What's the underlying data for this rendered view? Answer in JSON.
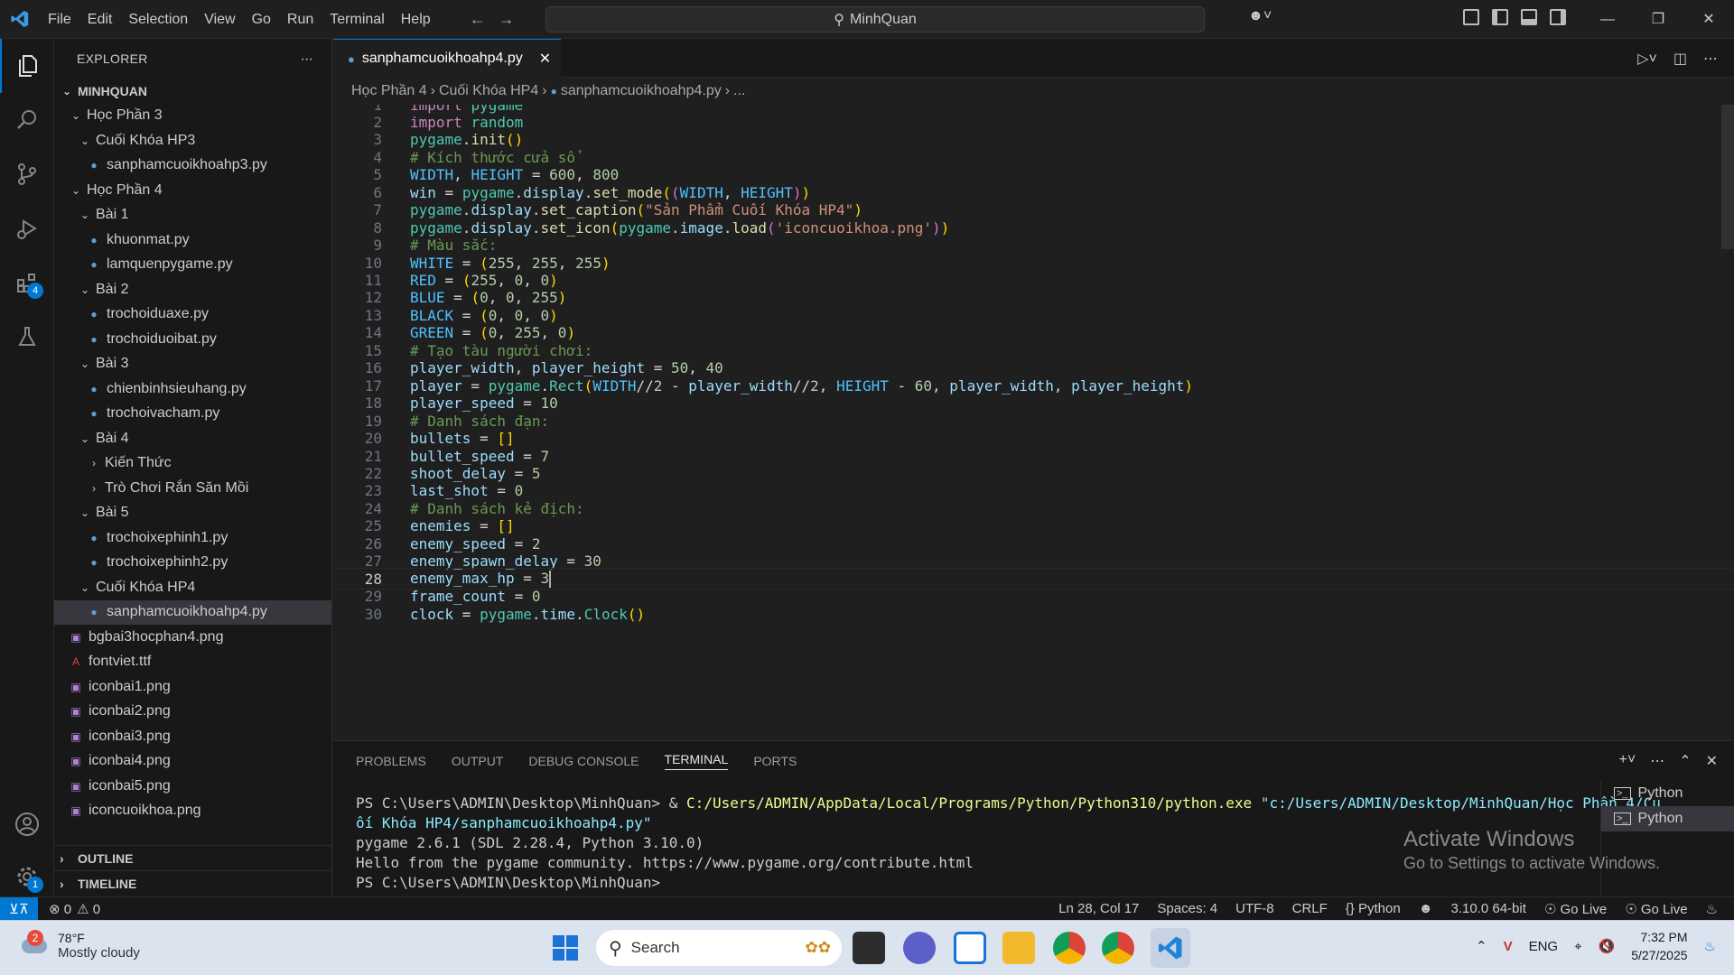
{
  "titlebar": {
    "menu": [
      "File",
      "Edit",
      "Selection",
      "View",
      "Go",
      "Run",
      "Terminal",
      "Help"
    ],
    "search": "MinhQuan"
  },
  "activitybar": {
    "extensions_badge": "4",
    "settings_badge": "1"
  },
  "explorer": {
    "title": "EXPLORER",
    "root": "MINHQUAN",
    "tree": [
      {
        "label": "Học Phần 3",
        "depth": 1,
        "kind": "folder-open"
      },
      {
        "label": "Cuối Khóa HP3",
        "depth": 2,
        "kind": "folder-open"
      },
      {
        "label": "sanphamcuoikhoahp3.py",
        "depth": 3,
        "kind": "py"
      },
      {
        "label": "Học Phần 4",
        "depth": 1,
        "kind": "folder-open"
      },
      {
        "label": "Bài 1",
        "depth": 2,
        "kind": "folder-open"
      },
      {
        "label": "khuonmat.py",
        "depth": 3,
        "kind": "py"
      },
      {
        "label": "lamquenpygame.py",
        "depth": 3,
        "kind": "py"
      },
      {
        "label": "Bài 2",
        "depth": 2,
        "kind": "folder-open"
      },
      {
        "label": "trochoiduaxe.py",
        "depth": 3,
        "kind": "py"
      },
      {
        "label": "trochoiduoibat.py",
        "depth": 3,
        "kind": "py"
      },
      {
        "label": "Bài 3",
        "depth": 2,
        "kind": "folder-open"
      },
      {
        "label": "chienbinhsieuhang.py",
        "depth": 3,
        "kind": "py"
      },
      {
        "label": "trochoivacham.py",
        "depth": 3,
        "kind": "py"
      },
      {
        "label": "Bài 4",
        "depth": 2,
        "kind": "folder-open"
      },
      {
        "label": "Kiến Thức",
        "depth": 3,
        "kind": "folder-closed"
      },
      {
        "label": "Trò Chơi Rắn Săn Mồi",
        "depth": 3,
        "kind": "folder-closed"
      },
      {
        "label": "Bài 5",
        "depth": 2,
        "kind": "folder-open"
      },
      {
        "label": "trochoixephinh1.py",
        "depth": 3,
        "kind": "py"
      },
      {
        "label": "trochoixephinh2.py",
        "depth": 3,
        "kind": "py"
      },
      {
        "label": "Cuối Khóa HP4",
        "depth": 2,
        "kind": "folder-open"
      },
      {
        "label": "sanphamcuoikhoahp4.py",
        "depth": 3,
        "kind": "py",
        "selected": true
      },
      {
        "label": "bgbai3hocphan4.png",
        "depth": 1,
        "kind": "img"
      },
      {
        "label": "fontviet.ttf",
        "depth": 1,
        "kind": "font"
      },
      {
        "label": "iconbai1.png",
        "depth": 1,
        "kind": "img"
      },
      {
        "label": "iconbai2.png",
        "depth": 1,
        "kind": "img"
      },
      {
        "label": "iconbai3.png",
        "depth": 1,
        "kind": "img"
      },
      {
        "label": "iconbai4.png",
        "depth": 1,
        "kind": "img"
      },
      {
        "label": "iconbai5.png",
        "depth": 1,
        "kind": "img"
      },
      {
        "label": "iconcuoikhoa.png",
        "depth": 1,
        "kind": "img"
      }
    ],
    "outline": "OUTLINE",
    "timeline": "TIMELINE"
  },
  "editor": {
    "tab": "sanphamcuoikhoahp4.py",
    "breadcrumb": [
      "Học Phần 4",
      "Cuối Khóa HP4",
      "sanphamcuoikhoahp4.py",
      "..."
    ],
    "current_line": 28
  },
  "code_lines": [
    [
      [
        "kw",
        "import"
      ],
      [
        "op",
        " "
      ],
      [
        "cls",
        "pygame"
      ]
    ],
    [
      [
        "kw",
        "import"
      ],
      [
        "op",
        " "
      ],
      [
        "cls",
        "random"
      ]
    ],
    [
      [
        "cls",
        "pygame"
      ],
      [
        "op",
        "."
      ],
      [
        "fn",
        "init"
      ],
      [
        "br1",
        "()"
      ]
    ],
    [
      [
        "cm",
        "# Kích thước cửa sổ"
      ]
    ],
    [
      [
        "con",
        "WIDTH"
      ],
      [
        "op",
        ", "
      ],
      [
        "con",
        "HEIGHT"
      ],
      [
        "op",
        " = "
      ],
      [
        "num",
        "600"
      ],
      [
        "op",
        ", "
      ],
      [
        "num",
        "800"
      ]
    ],
    [
      [
        "var",
        "win"
      ],
      [
        "op",
        " = "
      ],
      [
        "cls",
        "pygame"
      ],
      [
        "op",
        "."
      ],
      [
        "var",
        "display"
      ],
      [
        "op",
        "."
      ],
      [
        "fn",
        "set_mode"
      ],
      [
        "br1",
        "("
      ],
      [
        "br2",
        "("
      ],
      [
        "con",
        "WIDTH"
      ],
      [
        "op",
        ", "
      ],
      [
        "con",
        "HEIGHT"
      ],
      [
        "br2",
        ")"
      ],
      [
        "br1",
        ")"
      ]
    ],
    [
      [
        "cls",
        "pygame"
      ],
      [
        "op",
        "."
      ],
      [
        "var",
        "display"
      ],
      [
        "op",
        "."
      ],
      [
        "fn",
        "set_caption"
      ],
      [
        "br1",
        "("
      ],
      [
        "str",
        "\"Sản Phẩm Cuối Khóa HP4\""
      ],
      [
        "br1",
        ")"
      ]
    ],
    [
      [
        "cls",
        "pygame"
      ],
      [
        "op",
        "."
      ],
      [
        "var",
        "display"
      ],
      [
        "op",
        "."
      ],
      [
        "fn",
        "set_icon"
      ],
      [
        "br1",
        "("
      ],
      [
        "cls",
        "pygame"
      ],
      [
        "op",
        "."
      ],
      [
        "var",
        "image"
      ],
      [
        "op",
        "."
      ],
      [
        "fn",
        "load"
      ],
      [
        "br2",
        "("
      ],
      [
        "str",
        "'iconcuoikhoa.png'"
      ],
      [
        "br2",
        ")"
      ],
      [
        "br1",
        ")"
      ]
    ],
    [
      [
        "cm",
        "# Màu sắc:"
      ]
    ],
    [
      [
        "con",
        "WHITE"
      ],
      [
        "op",
        " = "
      ],
      [
        "br1",
        "("
      ],
      [
        "num",
        "255"
      ],
      [
        "op",
        ", "
      ],
      [
        "num",
        "255"
      ],
      [
        "op",
        ", "
      ],
      [
        "num",
        "255"
      ],
      [
        "br1",
        ")"
      ]
    ],
    [
      [
        "con",
        "RED"
      ],
      [
        "op",
        " = "
      ],
      [
        "br1",
        "("
      ],
      [
        "num",
        "255"
      ],
      [
        "op",
        ", "
      ],
      [
        "num",
        "0"
      ],
      [
        "op",
        ", "
      ],
      [
        "num",
        "0"
      ],
      [
        "br1",
        ")"
      ]
    ],
    [
      [
        "con",
        "BLUE"
      ],
      [
        "op",
        " = "
      ],
      [
        "br1",
        "("
      ],
      [
        "num",
        "0"
      ],
      [
        "op",
        ", "
      ],
      [
        "num",
        "0"
      ],
      [
        "op",
        ", "
      ],
      [
        "num",
        "255"
      ],
      [
        "br1",
        ")"
      ]
    ],
    [
      [
        "con",
        "BLACK"
      ],
      [
        "op",
        " = "
      ],
      [
        "br1",
        "("
      ],
      [
        "num",
        "0"
      ],
      [
        "op",
        ", "
      ],
      [
        "num",
        "0"
      ],
      [
        "op",
        ", "
      ],
      [
        "num",
        "0"
      ],
      [
        "br1",
        ")"
      ]
    ],
    [
      [
        "con",
        "GREEN"
      ],
      [
        "op",
        " = "
      ],
      [
        "br1",
        "("
      ],
      [
        "num",
        "0"
      ],
      [
        "op",
        ", "
      ],
      [
        "num",
        "255"
      ],
      [
        "op",
        ", "
      ],
      [
        "num",
        "0"
      ],
      [
        "br1",
        ")"
      ]
    ],
    [
      [
        "cm",
        "# Tạo tàu người chơi:"
      ]
    ],
    [
      [
        "var",
        "player_width"
      ],
      [
        "op",
        ", "
      ],
      [
        "var",
        "player_height"
      ],
      [
        "op",
        " = "
      ],
      [
        "num",
        "50"
      ],
      [
        "op",
        ", "
      ],
      [
        "num",
        "40"
      ]
    ],
    [
      [
        "var",
        "player"
      ],
      [
        "op",
        " = "
      ],
      [
        "cls",
        "pygame"
      ],
      [
        "op",
        "."
      ],
      [
        "cls",
        "Rect"
      ],
      [
        "br1",
        "("
      ],
      [
        "con",
        "WIDTH"
      ],
      [
        "op",
        "//"
      ],
      [
        "num",
        "2"
      ],
      [
        "op",
        " - "
      ],
      [
        "var",
        "player_width"
      ],
      [
        "op",
        "//"
      ],
      [
        "num",
        "2"
      ],
      [
        "op",
        ", "
      ],
      [
        "con",
        "HEIGHT"
      ],
      [
        "op",
        " - "
      ],
      [
        "num",
        "60"
      ],
      [
        "op",
        ", "
      ],
      [
        "var",
        "player_width"
      ],
      [
        "op",
        ", "
      ],
      [
        "var",
        "player_height"
      ],
      [
        "br1",
        ")"
      ]
    ],
    [
      [
        "var",
        "player_speed"
      ],
      [
        "op",
        " = "
      ],
      [
        "num",
        "10"
      ]
    ],
    [
      [
        "cm",
        "# Danh sách đạn:"
      ]
    ],
    [
      [
        "var",
        "bullets"
      ],
      [
        "op",
        " = "
      ],
      [
        "br1",
        "[]"
      ]
    ],
    [
      [
        "var",
        "bullet_speed"
      ],
      [
        "op",
        " = "
      ],
      [
        "num",
        "7"
      ]
    ],
    [
      [
        "var",
        "shoot_delay"
      ],
      [
        "op",
        " = "
      ],
      [
        "num",
        "5"
      ]
    ],
    [
      [
        "var",
        "last_shot"
      ],
      [
        "op",
        " = "
      ],
      [
        "num",
        "0"
      ]
    ],
    [
      [
        "cm",
        "# Danh sách kẻ địch:"
      ]
    ],
    [
      [
        "var",
        "enemies"
      ],
      [
        "op",
        " = "
      ],
      [
        "br1",
        "[]"
      ]
    ],
    [
      [
        "var",
        "enemy_speed"
      ],
      [
        "op",
        " = "
      ],
      [
        "num",
        "2"
      ]
    ],
    [
      [
        "var",
        "enemy_spawn_delay"
      ],
      [
        "op",
        " = "
      ],
      [
        "num",
        "30"
      ]
    ],
    [
      [
        "var",
        "enemy_max_hp"
      ],
      [
        "op",
        " = "
      ],
      [
        "num",
        "3"
      ]
    ],
    [
      [
        "var",
        "frame_count"
      ],
      [
        "op",
        " = "
      ],
      [
        "num",
        "0"
      ]
    ],
    [
      [
        "var",
        "clock"
      ],
      [
        "op",
        " = "
      ],
      [
        "cls",
        "pygame"
      ],
      [
        "op",
        "."
      ],
      [
        "var",
        "time"
      ],
      [
        "op",
        "."
      ],
      [
        "cls",
        "Clock"
      ],
      [
        "br1",
        "()"
      ]
    ]
  ],
  "panel": {
    "tabs": [
      "PROBLEMS",
      "OUTPUT",
      "DEBUG CONSOLE",
      "TERMINAL",
      "PORTS"
    ],
    "active_tab": "TERMINAL",
    "terminal": {
      "prompt1": "PS C:\\Users\\ADMIN\\Desktop\\MinhQuan> ",
      "amp": "& ",
      "exe": "C:/Users/ADMIN/AppData/Local/Programs/Python/Python310/python.exe",
      "arg1": " \"c:/Users/ADMIN/Desktop/MinhQuan/Học Phần 4/Cu",
      "arg2": "ối Khóa HP4/sanphamcuoikhoahp4.py\"",
      "out1": "pygame 2.6.1 (SDL 2.28.4, Python 3.10.0)",
      "out2": "Hello from the pygame community. https://www.pygame.org/contribute.html",
      "prompt2": "PS C:\\Users\\ADMIN\\Desktop\\MinhQuan> "
    },
    "terminals": [
      "Python",
      "Python"
    ],
    "watermark_title": "Activate Windows",
    "watermark_sub": "Go to Settings to activate Windows."
  },
  "statusbar": {
    "errors": "0",
    "warnings": "0",
    "position": "Ln 28, Col 17",
    "spaces": "Spaces: 4",
    "encoding": "UTF-8",
    "eol": "CRLF",
    "language": "Python",
    "interpreter": "3.10.0 64-bit",
    "golive1": "Go Live",
    "golive2": "Go Live"
  },
  "taskbar": {
    "temp": "78°F",
    "weather": "Mostly cloudy",
    "weather_badge": "2",
    "search": "Search",
    "lang": "ENG",
    "time": "7:32 PM",
    "date": "5/27/2025"
  },
  "colors": {
    "accent": "#0078d4",
    "editor_bg": "#1f1f1f",
    "sidebar_bg": "#181818"
  }
}
